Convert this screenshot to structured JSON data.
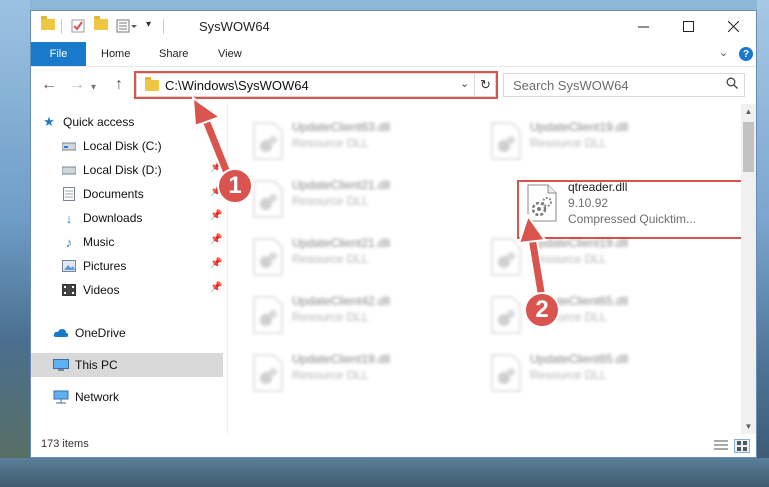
{
  "window": {
    "title": "SysWOW64"
  },
  "ribbon": {
    "tabs": [
      {
        "label": "File"
      },
      {
        "label": "Home"
      },
      {
        "label": "Share"
      },
      {
        "label": "View"
      }
    ],
    "help": "?"
  },
  "address": {
    "path": "C:\\Windows\\SysWOW64"
  },
  "search": {
    "placeholder": "Search SysWOW64"
  },
  "sidebar": {
    "items": [
      {
        "label": "Quick access",
        "icon": "star-icon"
      },
      {
        "label": "Local Disk (C:)",
        "icon": "drive-icon"
      },
      {
        "label": "Local Disk (D:)",
        "icon": "drive-icon"
      },
      {
        "label": "Documents",
        "icon": "documents-icon"
      },
      {
        "label": "Downloads",
        "icon": "download-icon"
      },
      {
        "label": "Music",
        "icon": "music-icon"
      },
      {
        "label": "Pictures",
        "icon": "pictures-icon"
      },
      {
        "label": "Videos",
        "icon": "videos-icon"
      },
      {
        "label": "OneDrive",
        "icon": "cloud-icon"
      },
      {
        "label": "This PC",
        "icon": "computer-icon"
      },
      {
        "label": "Network",
        "icon": "network-icon"
      }
    ]
  },
  "files": [
    {
      "name": "UpdateClient63.dll",
      "type": "Resource DLL"
    },
    {
      "name": "UpdateClient19.dll",
      "type": "Resource DLL"
    },
    {
      "name": "UpdateClient21.dll",
      "type": "Resource DLL"
    },
    {
      "name": "UpdateClient21.dll",
      "type": "Resource DLL"
    },
    {
      "name": "UpdateClient19.dll",
      "type": "Resource DLL"
    },
    {
      "name": "UpdateClient42.dll",
      "type": "Resource DLL"
    },
    {
      "name": "UpdateClient65.dll",
      "type": "Resource DLL"
    },
    {
      "name": "UpdateClient19.dll",
      "type": "Resource DLL"
    },
    {
      "name": "UpdateClient65.dll",
      "type": "Resource DLL"
    }
  ],
  "target_file": {
    "name": "qtreader.dll",
    "version": "9.10.92",
    "type": "Compressed Quicktim..."
  },
  "status": {
    "count": "173 items"
  },
  "annotations": {
    "step1": "1",
    "step2": "2"
  },
  "colors": {
    "accent": "#1979ca",
    "annotation": "#d9534f"
  }
}
